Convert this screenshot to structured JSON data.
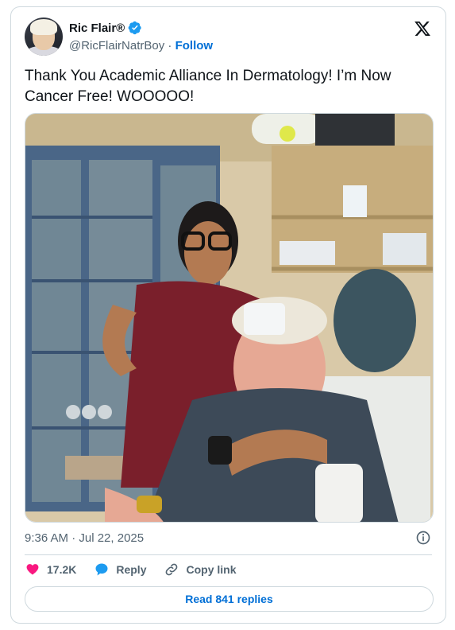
{
  "author": {
    "name": "Ric Flair®",
    "handle": "@RicFlairNatrBoy",
    "separator": "·",
    "follow_label": "Follow",
    "verified": true,
    "verified_color": "#1d9bf0"
  },
  "tweet": {
    "text": "Thank You Academic Alliance In Dermatology! I’m Now Cancer Free! WOOOOO!",
    "timestamp": "9:36 AM · Jul 22, 2025"
  },
  "media": {
    "alt": "Photo of a smiling man with a bandage on his forehead seated in a dermatology exam chair beside a smiling woman in maroon scrubs"
  },
  "actions": {
    "likes_count": "17.2K",
    "reply_label": "Reply",
    "copy_link_label": "Copy link"
  },
  "replies_button_label": "Read 841 replies",
  "icons": [
    "x-logo-icon",
    "verified-badge-icon",
    "info-icon",
    "heart-icon",
    "reply-bubble-icon",
    "link-icon"
  ],
  "colors": {
    "accent": "#006fd6",
    "like": "#f91880",
    "border": "#cfd9de",
    "muted": "#536471"
  }
}
